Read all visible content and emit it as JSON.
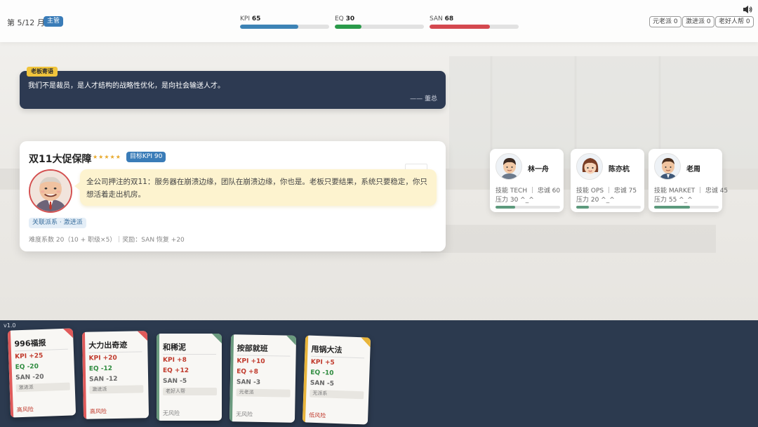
{
  "header": {
    "month_text": "第 5/12 月",
    "role_badge": "主管",
    "stats": [
      {
        "label": "KPI",
        "value": 65,
        "color": "#3d83b6"
      },
      {
        "label": "EQ",
        "value": 30,
        "color": "#2a9a4a"
      },
      {
        "label": "SAN",
        "value": 68,
        "color": "#d4484f"
      }
    ],
    "factions": [
      "元老派 0",
      "激进派 0",
      "老好人帮 0"
    ]
  },
  "quote": {
    "tag": "老板寄语",
    "text": "我们不是裁员，是人才结构的战略性优化，是向社会输送人才。",
    "author": "—— 董总"
  },
  "event": {
    "title": "双11大促保障",
    "stars": "★★★★★",
    "target": "目标KPI 90",
    "description": "全公司押注的双11：服务器在崩溃边缘，团队在崩溃边缘，你也是。老板只要结果，系统只要稳定，你只想活着走出机房。",
    "related_tag": "关联派系 · 激进派",
    "difficulty": "难度系数 20（10 + 职级×5）｜奖励：SAN 恢复 +20"
  },
  "employees": [
    {
      "name": "林一舟",
      "skill": "技能 TECH ｜ 忠诚 60",
      "stress_text": "压力 30 ^_^",
      "stress": 30
    },
    {
      "name": "陈亦杭",
      "skill": "技能 OPS ｜ 忠诚 75",
      "stress_text": "压力 20 ^_^",
      "stress": 20
    },
    {
      "name": "老周",
      "skill": "技能 MARKET ｜ 忠诚 45",
      "stress_text": "压力 55 ^_^",
      "stress": 55
    }
  ],
  "version": "v1.0",
  "cards": [
    {
      "title": "996福报",
      "kpi": "KPI +25",
      "eq": "EQ -20",
      "san": "SAN -20",
      "faction": "激进派",
      "risk": "高风险",
      "risk_color": "#c0392b",
      "accent": "#e05a5a"
    },
    {
      "title": "大力出奇迹",
      "kpi": "KPI +20",
      "eq": "EQ -12",
      "san": "SAN -12",
      "faction": "激进派",
      "risk": "高风险",
      "risk_color": "#c0392b",
      "accent": "#e05a5a"
    },
    {
      "title": "和稀泥",
      "kpi": "KPI +8",
      "eq": "EQ +12",
      "san": "SAN -5",
      "faction": "老好人帮",
      "risk": "无风险",
      "risk_color": "#888888",
      "accent": "#6a9a7e"
    },
    {
      "title": "按部就班",
      "kpi": "KPI +10",
      "eq": "EQ +8",
      "san": "SAN -3",
      "faction": "元老派",
      "risk": "无风险",
      "risk_color": "#888888",
      "accent": "#6a9a7e"
    },
    {
      "title": "甩锅大法",
      "kpi": "KPI +5",
      "eq": "EQ -10",
      "san": "SAN -5",
      "faction": "无派系",
      "risk": "低风险",
      "risk_color": "#c0392b",
      "accent": "#e8b43a"
    }
  ]
}
